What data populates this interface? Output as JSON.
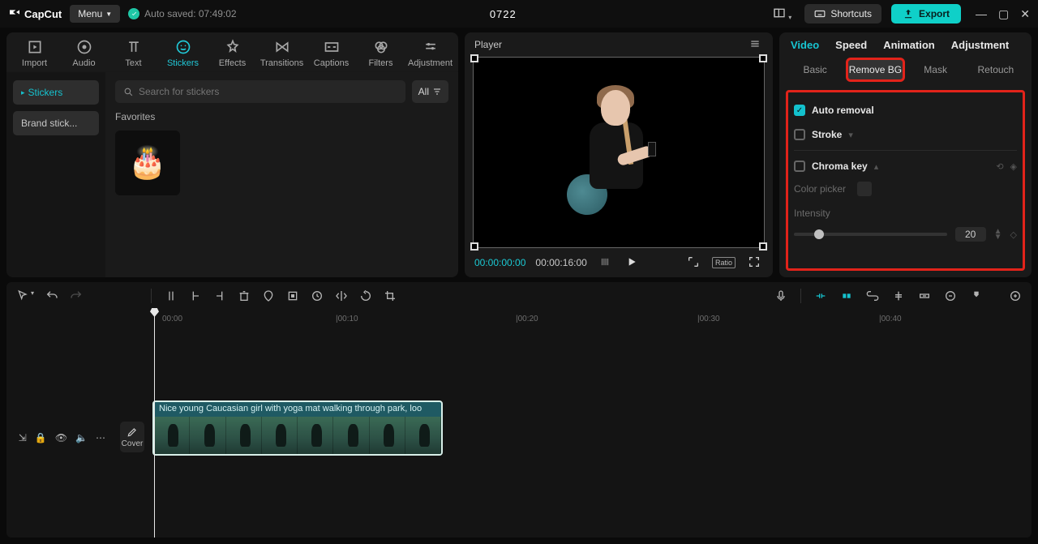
{
  "app": {
    "name": "CapCut",
    "project_title": "0722"
  },
  "titlebar": {
    "menu_label": "Menu",
    "autosave_text": "Auto saved: 07:49:02",
    "shortcuts_label": "Shortcuts",
    "export_label": "Export"
  },
  "media_tabs": {
    "import": "Import",
    "audio": "Audio",
    "text": "Text",
    "stickers": "Stickers",
    "effects": "Effects",
    "transitions": "Transitions",
    "captions": "Captions",
    "filters": "Filters",
    "adjustment": "Adjustment"
  },
  "stickers_sidebar": {
    "stickers": "Stickers",
    "brand": "Brand stick..."
  },
  "stickers_main": {
    "search_placeholder": "Search for stickers",
    "all_label": "All",
    "favorites_label": "Favorites",
    "fav_icon": "birthday-cake-icon"
  },
  "player": {
    "title": "Player",
    "tc_current": "00:00:00:00",
    "tc_total": "00:00:16:00",
    "ratio_label": "Ratio"
  },
  "inspector": {
    "tabs1": {
      "video": "Video",
      "speed": "Speed",
      "animation": "Animation",
      "adjustment": "Adjustment"
    },
    "tabs2": {
      "basic": "Basic",
      "removebg": "Remove BG",
      "mask": "Mask",
      "retouch": "Retouch"
    },
    "auto_removal": "Auto removal",
    "stroke": "Stroke",
    "chroma_key": "Chroma key",
    "color_picker_label": "Color picker",
    "intensity_label": "Intensity",
    "intensity_value": "20"
  },
  "timeline": {
    "cover_label": "Cover",
    "ruler_labels": [
      "00:00",
      "|00:10",
      "|00:20",
      "|00:30",
      "|00:40"
    ],
    "clip_title": "Nice young Caucasian girl with yoga mat walking through park, loo"
  }
}
